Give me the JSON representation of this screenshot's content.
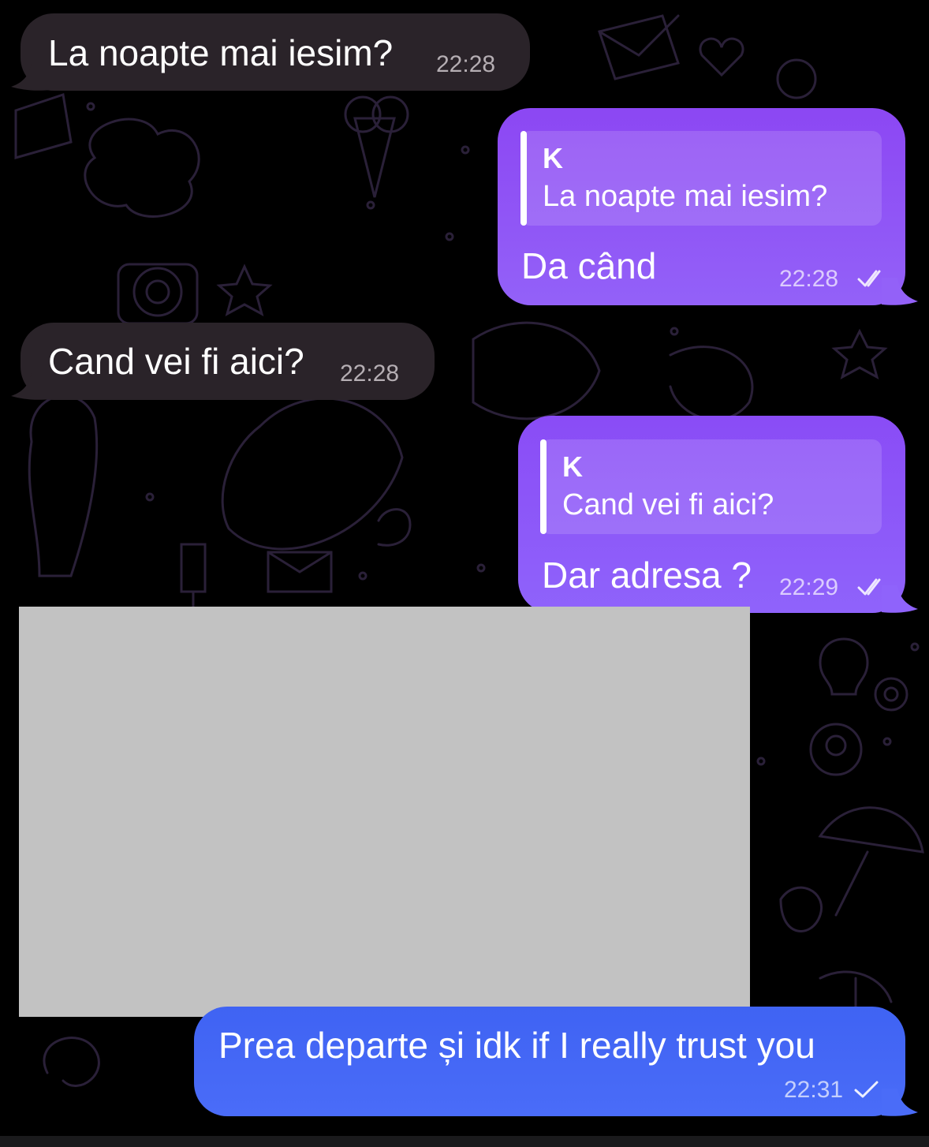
{
  "colors": {
    "background": "#000000",
    "incoming_bubble": "#2a2329",
    "outgoing_bubble": "#8c47f3",
    "outgoing_blue_bubble": "#3f63f3",
    "redacted_block": "#c2c2c2"
  },
  "messages": [
    {
      "text": "La noapte mai iesim?",
      "time": "22:28"
    },
    {
      "reply": {
        "name": "K",
        "text": "La noapte mai iesim?"
      },
      "text": "Da când",
      "time": "22:28",
      "status_icon": "double-check-icon"
    },
    {
      "text": "Cand vei fi aici?",
      "time": "22:28"
    },
    {
      "reply": {
        "name": "K",
        "text": "Cand vei fi aici?"
      },
      "text": "Dar adresa ?",
      "time": "22:29",
      "status_icon": "double-check-icon"
    },
    {
      "text": "Prea departe și idk if I really trust you",
      "time": "22:31",
      "status_icon": "single-check-icon"
    }
  ]
}
